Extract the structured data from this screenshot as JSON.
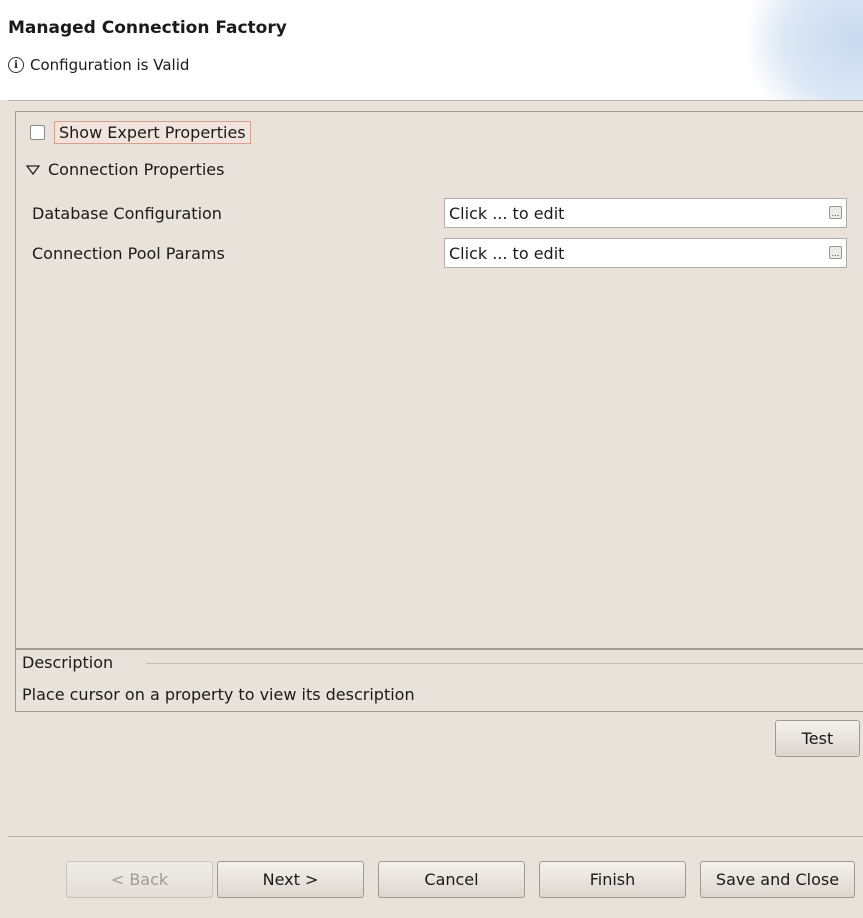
{
  "header": {
    "title": "Managed Connection Factory",
    "status_icon": "info-icon",
    "status_text": "Configuration is Valid"
  },
  "properties": {
    "show_expert_label": "Show Expert Properties",
    "show_expert_checked": false,
    "section_label": "Connection Properties",
    "section_icon": "triangle-down-icon",
    "rows": [
      {
        "label": "Database Configuration",
        "value": "Click ... to edit",
        "button_icon": "ellipsis-icon"
      },
      {
        "label": "Connection Pool Params",
        "value": "Click ... to edit",
        "button_icon": "ellipsis-icon"
      }
    ]
  },
  "description": {
    "heading": "Description",
    "text": "Place cursor on a property to view its description"
  },
  "buttons": {
    "test": "Test",
    "back": "< Back",
    "next": "Next >",
    "cancel": "Cancel",
    "finish": "Finish",
    "save_close": "Save and Close"
  },
  "colors": {
    "background": "#e8e2da",
    "highlight_border": "#d79f8c"
  }
}
